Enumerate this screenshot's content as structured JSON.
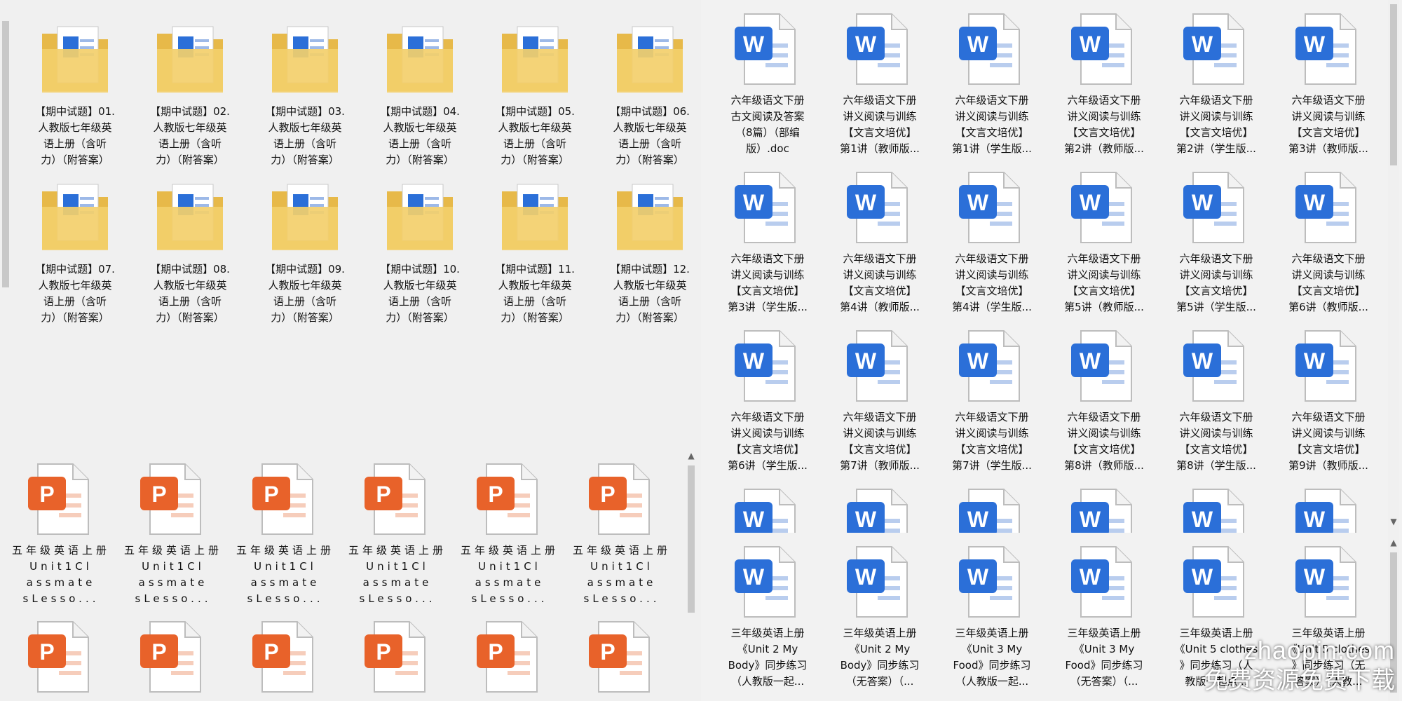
{
  "folders": [
    {
      "label": "【期中试题】01.\n人教版七年级英\n语上册（含听\n力）（附答案）"
    },
    {
      "label": "【期中试题】02.\n人教版七年级英\n语上册（含听\n力）（附答案）"
    },
    {
      "label": "【期中试题】03.\n人教版七年级英\n语上册（含听\n力）（附答案）"
    },
    {
      "label": "【期中试题】04.\n人教版七年级英\n语上册（含听\n力）（附答案）"
    },
    {
      "label": "【期中试题】05.\n人教版七年级英\n语上册（含听\n力）（附答案）"
    },
    {
      "label": "【期中试题】06.\n人教版七年级英\n语上册（含听\n力）（附答案）"
    },
    {
      "label": "【期中试题】07.\n人教版七年级英\n语上册（含听\n力）（附答案）"
    },
    {
      "label": "【期中试题】08.\n人教版七年级英\n语上册（含听\n力）（附答案）"
    },
    {
      "label": "【期中试题】09.\n人教版七年级英\n语上册（含听\n力）（附答案）"
    },
    {
      "label": "【期中试题】10.\n人教版七年级英\n语上册（含听\n力）（附答案）"
    },
    {
      "label": "【期中试题】11.\n人教版七年级英\n语上册（含听\n力）（附答案）"
    },
    {
      "label": "【期中试题】12.\n人教版七年级英\n语上册（含听\n力）（附答案）"
    }
  ],
  "ppt_files": [
    {
      "label": "五年级英语上册\nUnit1Cl\nassmate\nsLesso..."
    },
    {
      "label": "五年级英语上册\nUnit1Cl\nassmate\nsLesso..."
    },
    {
      "label": "五年级英语上册\nUnit1Cl\nassmate\nsLesso..."
    },
    {
      "label": "五年级英语上册\nUnit1Cl\nassmate\nsLesso..."
    },
    {
      "label": "五年级英语上册\nUnit1Cl\nassmate\nsLesso..."
    },
    {
      "label": "五年级英语上册\nUnit1Cl\nassmate\nsLesso..."
    },
    {
      "label": ""
    },
    {
      "label": ""
    },
    {
      "label": ""
    },
    {
      "label": ""
    },
    {
      "label": ""
    },
    {
      "label": ""
    }
  ],
  "word_files": [
    {
      "label": "六年级语文下册\n古文阅读及答案\n（8篇）（部编\n版）.doc"
    },
    {
      "label": "六年级语文下册\n讲义阅读与训练\n【文言文培优】\n第1讲（教师版..."
    },
    {
      "label": "六年级语文下册\n讲义阅读与训练\n【文言文培优】\n第1讲（学生版..."
    },
    {
      "label": "六年级语文下册\n讲义阅读与训练\n【文言文培优】\n第2讲（教师版..."
    },
    {
      "label": "六年级语文下册\n讲义阅读与训练\n【文言文培优】\n第2讲（学生版..."
    },
    {
      "label": "六年级语文下册\n讲义阅读与训练\n【文言文培优】\n第3讲（教师版..."
    },
    {
      "label": "六年级语文下册\n讲义阅读与训练\n【文言文培优】\n第3讲（学生版..."
    },
    {
      "label": "六年级语文下册\n讲义阅读与训练\n【文言文培优】\n第4讲（教师版..."
    },
    {
      "label": "六年级语文下册\n讲义阅读与训练\n【文言文培优】\n第4讲（学生版..."
    },
    {
      "label": "六年级语文下册\n讲义阅读与训练\n【文言文培优】\n第5讲（教师版..."
    },
    {
      "label": "六年级语文下册\n讲义阅读与训练\n【文言文培优】\n第5讲（学生版..."
    },
    {
      "label": "六年级语文下册\n讲义阅读与训练\n【文言文培优】\n第6讲（教师版..."
    },
    {
      "label": "六年级语文下册\n讲义阅读与训练\n【文言文培优】\n第6讲（学生版..."
    },
    {
      "label": "六年级语文下册\n讲义阅读与训练\n【文言文培优】\n第7讲（教师版..."
    },
    {
      "label": "六年级语文下册\n讲义阅读与训练\n【文言文培优】\n第7讲（学生版..."
    },
    {
      "label": "六年级语文下册\n讲义阅读与训练\n【文言文培优】\n第8讲（教师版..."
    },
    {
      "label": "六年级语文下册\n讲义阅读与训练\n【文言文培优】\n第8讲（学生版..."
    },
    {
      "label": "六年级语文下册\n讲义阅读与训练\n【文言文培优】\n第9讲（教师版..."
    },
    {
      "label": ""
    },
    {
      "label": ""
    },
    {
      "label": ""
    },
    {
      "label": ""
    },
    {
      "label": ""
    },
    {
      "label": ""
    }
  ],
  "word_files_2": [
    {
      "label": "三年级英语上册\n《Unit 2 My\nBody》同步练习\n（人教版一起..."
    },
    {
      "label": "三年级英语上册\n《Unit 2 My\nBody》同步练习\n（无答案）（..."
    },
    {
      "label": "三年级英语上册\n《Unit 3 My\nFood》同步练习\n（人教版一起..."
    },
    {
      "label": "三年级英语上册\n《Unit 3 My\nFood》同步练习\n（无答案）（..."
    },
    {
      "label": "三年级英语上册\n《Unit 5 clothes\n》同步练习（人\n教版一起点..."
    },
    {
      "label": "三年级英语上册\n《Unit 5 clothes\n》同步练习（无\n答案）（人教..."
    }
  ],
  "icon_letters": {
    "word": "W",
    "ppt": "P"
  },
  "watermark": {
    "line1": "zhaopin.com",
    "line2": "免费资源免费下载"
  },
  "colors": {
    "word_blue": "#2b6fd8",
    "ppt_orange": "#e8622a",
    "folder_yellow": "#f3cf6b"
  }
}
